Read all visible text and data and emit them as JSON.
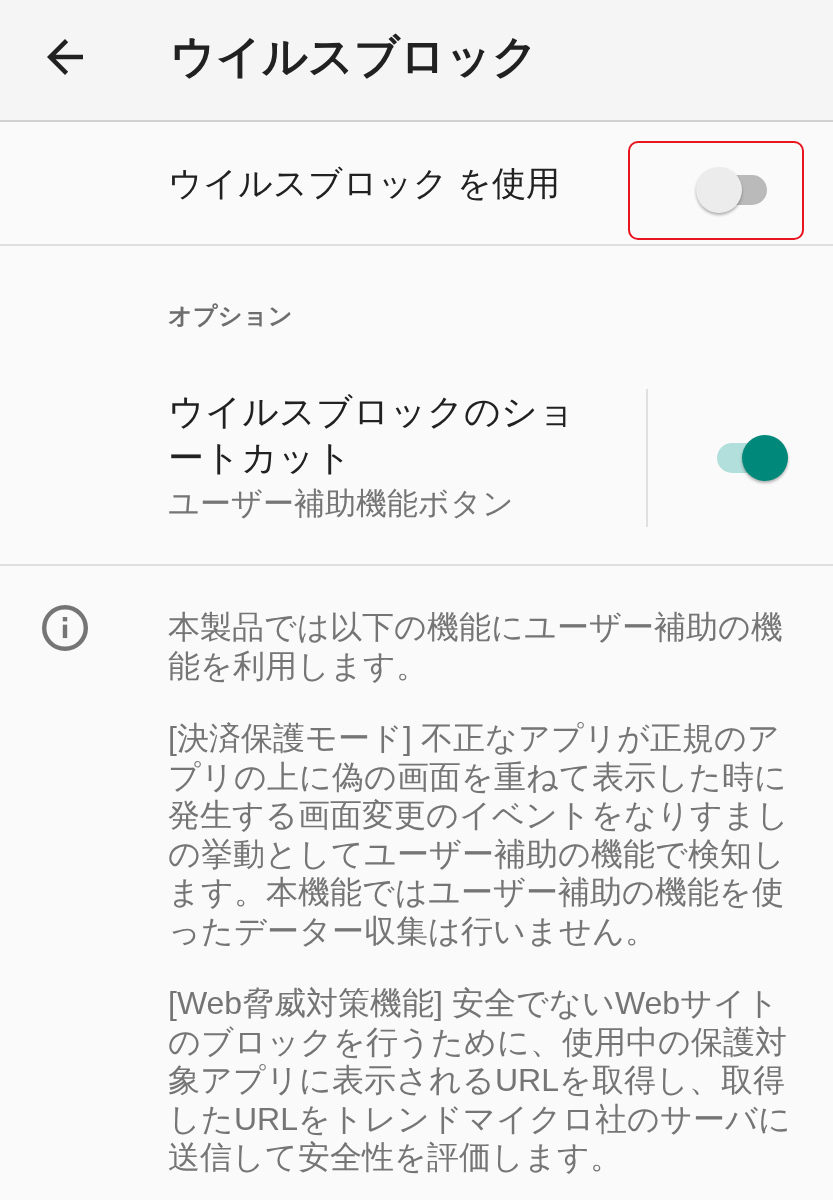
{
  "app_bar": {
    "title": "ウイルスブロック"
  },
  "main_switch": {
    "label": "ウイルスブロック を使用",
    "on": false,
    "highlighted": true
  },
  "sections": [
    {
      "header": "オプション",
      "items": [
        {
          "title": "ウイルスブロックのショートカット",
          "summary": "ユーザー補助機能ボタン",
          "on": true
        }
      ]
    }
  ],
  "info": {
    "paragraphs": [
      "本製品では以下の機能にユーザー補助の機能を利用します。",
      "[決済保護モード] 不正なアプリが正規のアプリの上に偽の画面を重ねて表示した時に発生する画面変更のイベントをなりすましの挙動としてユーザー補助の機能で検知します。本機能ではユーザー補助の機能を使ったデーター収集は行いません。",
      "[Web脅威対策機能] 安全でないWebサイトのブロックを行うために、使用中の保護対象アプリに表示されるURLを取得し、取得したURLをトレンドマイクロ社のサーバに送信して安全性を評価します。"
    ]
  }
}
